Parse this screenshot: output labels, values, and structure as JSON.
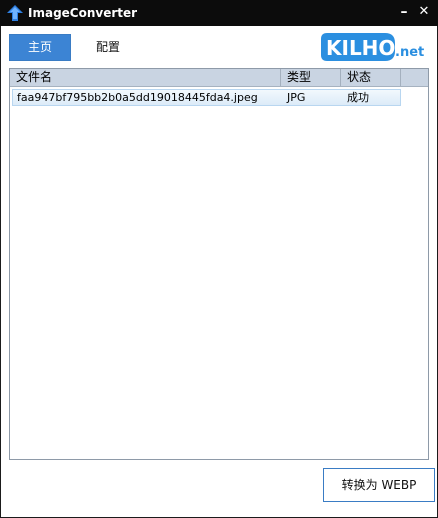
{
  "window": {
    "title": "ImageConverter",
    "minimize_glyph": "–",
    "close_glyph": "✕"
  },
  "nav": {
    "home_label": "主页",
    "config_label": "配置"
  },
  "logo": {
    "text_main": "KILHO",
    "text_suffix": ".net",
    "brand_color": "#2b8fe0"
  },
  "table": {
    "columns": [
      "文件名",
      "类型",
      "状态"
    ],
    "rows": [
      {
        "filename": "faa947bf795bb2b0a5dd19018445fda4.jpeg",
        "type": "JPG",
        "status": "成功"
      }
    ]
  },
  "actions": {
    "convert_label": "转换为 WEBP"
  },
  "colors": {
    "accent": "#3c84d4",
    "header_bg": "#c9d4e2",
    "selected_row": "#dcebf8"
  }
}
